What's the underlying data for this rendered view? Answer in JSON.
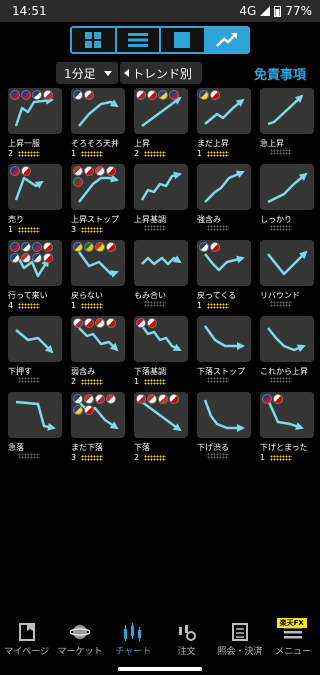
{
  "status": {
    "time": "14:51",
    "network": "4G",
    "battery": "77%"
  },
  "view_toggle": {
    "options": [
      "grid-view",
      "list-view",
      "single-view",
      "trend-view"
    ]
  },
  "controls": {
    "timeframe": "1分足",
    "trend_filter": "トレンド別",
    "disclaimer": "免責事項"
  },
  "colors": {
    "accent": "#2ea3d8",
    "count_dots": "#ffd400"
  },
  "patterns": [
    {
      "label": "上昇一服",
      "count": "2",
      "flags": [
        "nz",
        "gb",
        "au",
        "us"
      ],
      "shape": "up-flat"
    },
    {
      "label": "そろそろ天井",
      "count": "1",
      "flags": [
        "au",
        "us"
      ],
      "shape": "up-top"
    },
    {
      "label": "上昇",
      "count": "2",
      "flags": [
        "us",
        "jp",
        "eu",
        "nz"
      ],
      "shape": "up"
    },
    {
      "label": "まだ上昇",
      "count": "1",
      "flags": [
        "eu",
        "jp"
      ],
      "shape": "up-step"
    },
    {
      "label": "急上昇",
      "count": "",
      "flags": [],
      "shape": "sharp-up"
    },
    {
      "label": "売り",
      "count": "1",
      "flags": [
        "gb",
        "jp"
      ],
      "shape": "peak"
    },
    {
      "label": "上昇ストップ",
      "count": "3",
      "flags": [
        "ch",
        "jp",
        "sg",
        "jp",
        "mx"
      ],
      "shape": "up-stop"
    },
    {
      "label": "上昇基調",
      "count": "",
      "flags": [],
      "shape": "uptrend"
    },
    {
      "label": "強含み",
      "count": "",
      "flags": [],
      "shape": "firm"
    },
    {
      "label": "しっかり",
      "count": "",
      "flags": [],
      "shape": "steady"
    },
    {
      "label": "行って来い",
      "count": "4",
      "flags": [
        "nz",
        "au",
        "gb",
        "jp",
        "au",
        "ch",
        "au",
        "jp"
      ],
      "shape": "roundtrip"
    },
    {
      "label": "戻らない",
      "count": "1",
      "flags": [
        "eu",
        "za",
        "cn",
        "jp"
      ],
      "shape": "norecover"
    },
    {
      "label": "もみ合い",
      "count": "",
      "flags": [],
      "shape": "range"
    },
    {
      "label": "戻ってくる",
      "count": "1",
      "flags": [
        "au",
        "jp"
      ],
      "shape": "comeback"
    },
    {
      "label": "リバウンド",
      "count": "",
      "flags": [],
      "shape": "rebound"
    },
    {
      "label": "下押す",
      "count": "",
      "flags": [],
      "shape": "push-down"
    },
    {
      "label": "弱含み",
      "count": "2",
      "flags": [
        "us",
        "jp",
        "hk",
        "jp"
      ],
      "shape": "weak"
    },
    {
      "label": "下落基調",
      "count": "1",
      "flags": [
        "tr",
        "jp"
      ],
      "shape": "downtrend"
    },
    {
      "label": "下落ストップ",
      "count": "",
      "flags": [],
      "shape": "down-stop"
    },
    {
      "label": "これから上昇",
      "count": "",
      "flags": [],
      "shape": "about-up"
    },
    {
      "label": "急落",
      "count": "",
      "flags": [],
      "shape": "crash"
    },
    {
      "label": "まだ下落",
      "count": "3",
      "flags": [
        "au",
        "ch",
        "us",
        "ch",
        "eu",
        "jp"
      ],
      "shape": "still-down"
    },
    {
      "label": "下落",
      "count": "2",
      "flags": [
        "us",
        "ch",
        "ca",
        "jp"
      ],
      "shape": "down"
    },
    {
      "label": "下げ渋る",
      "count": "",
      "flags": [],
      "shape": "down-slow"
    },
    {
      "label": "下げとまった",
      "count": "1",
      "flags": [
        "gb",
        "jp"
      ],
      "shape": "down-stopped"
    }
  ],
  "nav": [
    {
      "label": "マイページ",
      "icon": "bookmark-icon"
    },
    {
      "label": "マーケット",
      "icon": "globe-icon"
    },
    {
      "label": "チャート",
      "icon": "candle-icon",
      "active": true
    },
    {
      "label": "注文",
      "icon": "order-icon"
    },
    {
      "label": "照会・決済",
      "icon": "document-icon"
    },
    {
      "label": "メニュー",
      "icon": "menu-icon",
      "badge": "楽天FX"
    }
  ]
}
